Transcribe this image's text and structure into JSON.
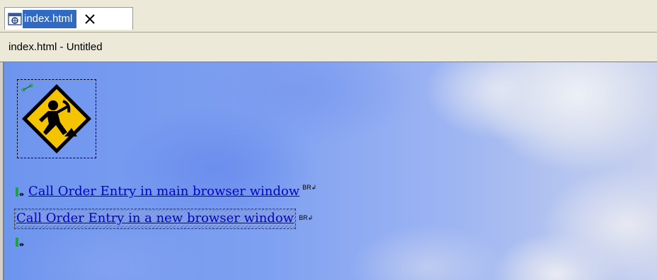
{
  "tab": {
    "label": "index.html",
    "icon": "html-file-icon",
    "close_icon": "close-icon"
  },
  "title": "index.html - Untitled",
  "content": {
    "image_icon": "construction-worker-sign-icon",
    "links": [
      {
        "text": "Call Order Entry in main browser window",
        "marker": "script-anchor-icon",
        "br_glyph": "BR↲"
      },
      {
        "text": "Call Order Entry in a new browser window",
        "br_glyph": "BR↲"
      }
    ],
    "trailing_marker": "script-anchor-icon"
  },
  "colors": {
    "link": "#0000cc",
    "tab_highlight": "#316ac5",
    "sign_yellow": "#f5c400"
  }
}
